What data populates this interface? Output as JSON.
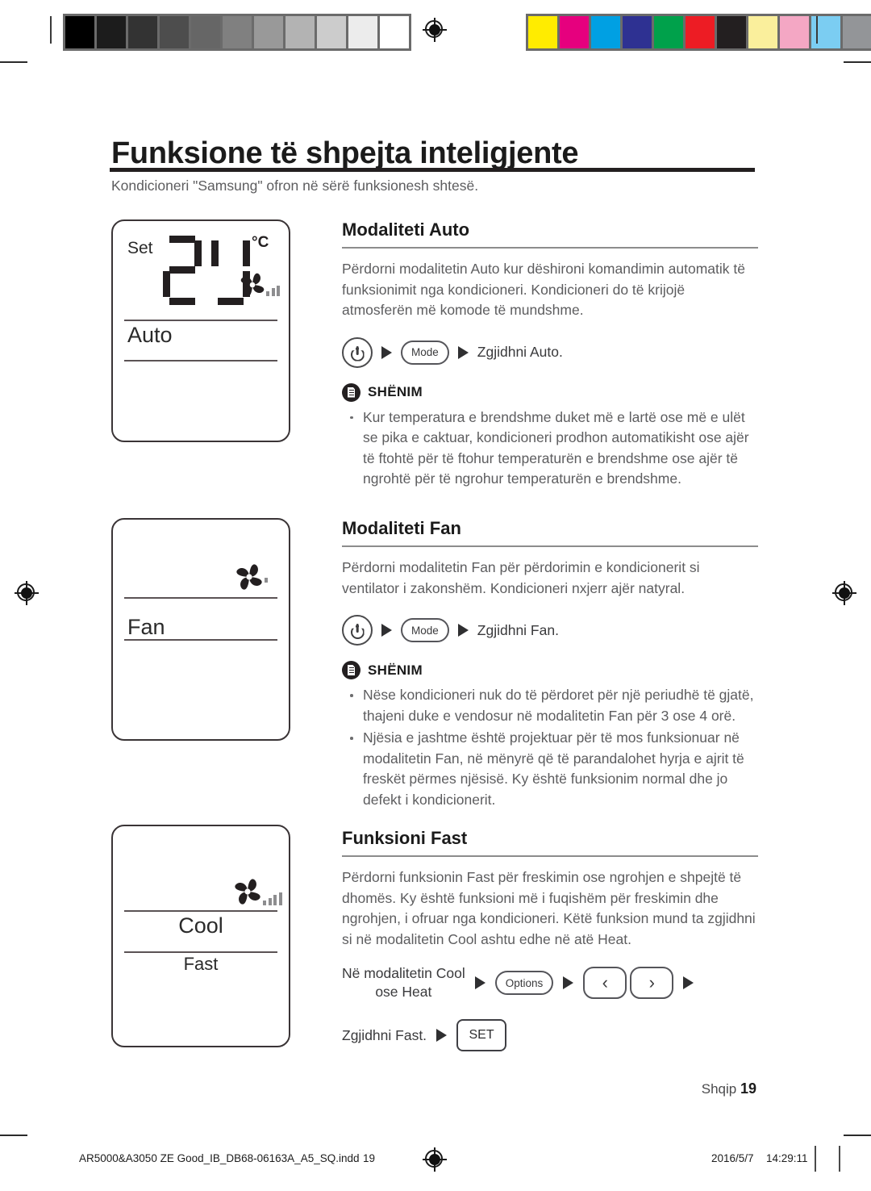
{
  "document": {
    "title": "Funksione të shpejta inteligjente",
    "subtitle": "Kondicioneri \"Samsung\" ofron në sërë funksionesh shtesë.",
    "page_label": "Shqip",
    "page_number": "19"
  },
  "displays": [
    {
      "name": "auto",
      "set_label": "Set",
      "temperature": "24",
      "unit": "°C",
      "mode_text": "Auto",
      "fan_bars": 3
    },
    {
      "name": "fan",
      "mode_text": "Fan",
      "fan_bars": 1
    },
    {
      "name": "cool",
      "mode_text": "Cool",
      "sub_text": "Fast",
      "fan_bars": 4
    }
  ],
  "sections": [
    {
      "heading": "Modaliteti Auto",
      "body": "Përdorni modalitetin Auto kur dëshironi komandimin automatik të funksionimit nga kondicioneri. Kondicioneri do të krijojë atmosferën më komode të mundshme.",
      "steps": {
        "power_icon": "power-icon",
        "mode_button": "Mode",
        "instruction": "Zgjidhni Auto."
      },
      "note_title": "SHËNIM",
      "note_icon": "document-note-icon",
      "bullets": [
        "Kur temperatura e brendshme duket më e lartë ose më e ulët se pika e caktuar, kondicioneri prodhon automatikisht ose ajër të ftohtë për të ftohur temperaturën e brendshme ose ajër të ngrohtë për të ngrohur temperaturën e brendshme."
      ]
    },
    {
      "heading": "Modaliteti Fan",
      "body": "Përdorni modalitetin Fan për përdorimin e kondicionerit si ventilator i zakonshëm. Kondicioneri nxjerr ajër natyral.",
      "steps": {
        "power_icon": "power-icon",
        "mode_button": "Mode",
        "instruction": "Zgjidhni Fan."
      },
      "note_title": "SHËNIM",
      "note_icon": "document-note-icon",
      "bullets": [
        "Nëse kondicioneri nuk do të përdoret për një periudhë të gjatë, thajeni duke e vendosur në modalitetin Fan për 3 ose 4 orë.",
        "Njësia e jashtme është projektuar për të mos funksionuar në modalitetin Fan, në mënyrë që të parandalohet hyrja e ajrit të freskët përmes njësisë. Ky është funksionim normal dhe jo defekt i kondicionerit."
      ]
    },
    {
      "heading": "Funksioni Fast",
      "body": "Përdorni funksionin Fast për freskimin ose ngrohjen e shpejtë të dhomës. Ky është funksioni më i fuqishëm për freskimin dhe ngrohjen, i ofruar nga kondicioneri. Këtë funksion mund ta zgjidhni si në modalitetin Cool ashtu edhe në atë Heat.",
      "fast_steps": {
        "prefix_line1": "Në modalitetin Cool",
        "prefix_line2": "ose Heat",
        "options_button": "Options",
        "left_arrow": "‹",
        "right_arrow": "›",
        "final_label": "Zgjidhni Fast.",
        "set_button": "SET"
      }
    }
  ],
  "print_strip": {
    "grayscale": [
      "#000000",
      "#1c1c1c",
      "#333333",
      "#4d4d4d",
      "#666666",
      "#808080",
      "#999999",
      "#b3b3b3",
      "#cccccc",
      "#ececec",
      "#ffffff"
    ],
    "colors": [
      "#ffec00",
      "#e6007e",
      "#00a0e3",
      "#2e3192",
      "#00a14b",
      "#ed1c24",
      "#231f20",
      "#faef9c",
      "#f4a7c4",
      "#7bcdf2",
      "#939598"
    ]
  },
  "production_footer": {
    "filename": "AR5000&A3050 ZE Good_IB_DB68-06163A_A5_SQ.indd",
    "page": "19",
    "date": "2016/5/7",
    "time": "14:29:11"
  }
}
